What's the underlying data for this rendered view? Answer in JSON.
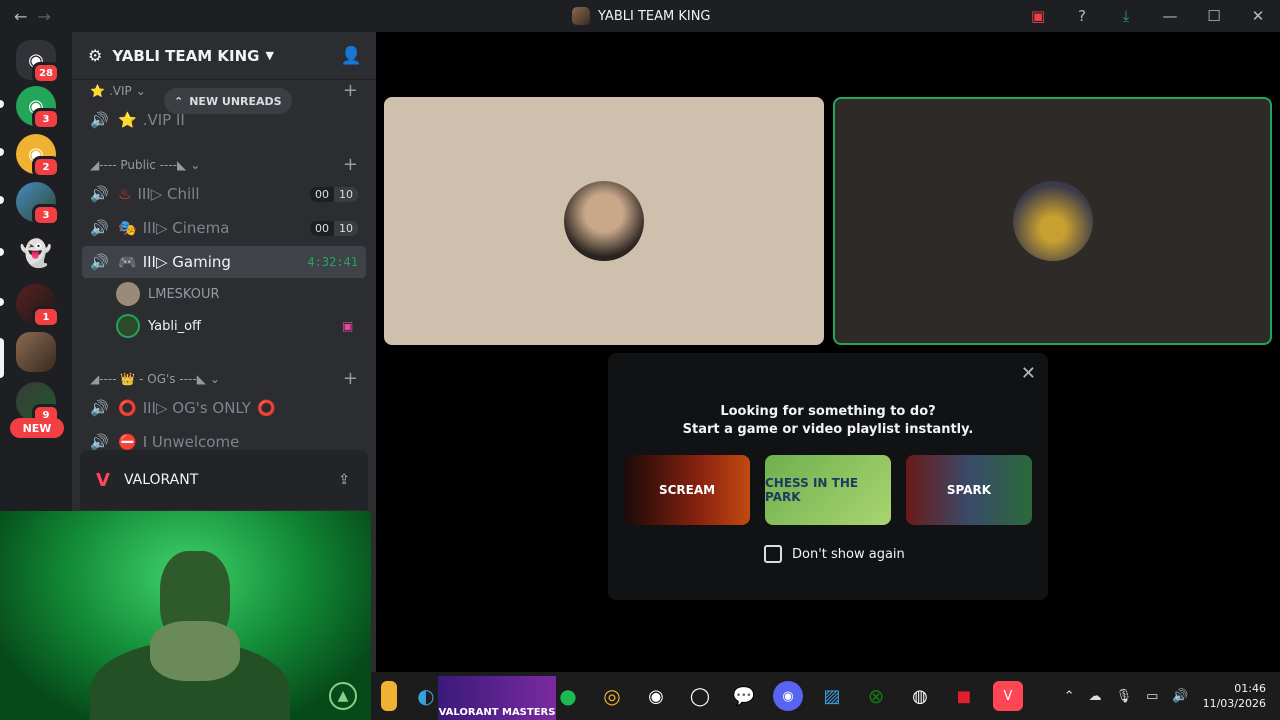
{
  "window": {
    "title": "YABLI TEAM KING",
    "back_icon": "arrow-left-icon",
    "forward_icon": "arrow-right-icon",
    "controls": {
      "minimize": "—",
      "maximize": "☐",
      "close": "✕"
    }
  },
  "rail": {
    "dm_badge": "28",
    "servers": [
      {
        "badge": "3"
      },
      {
        "badge": "2"
      },
      {
        "badge": "3"
      },
      {
        "badge": ""
      },
      {
        "badge": "1"
      },
      {
        "badge": ""
      },
      {
        "badge": "9"
      }
    ],
    "new_label": "NEW"
  },
  "server": {
    "name": "YABLI TEAM KING",
    "new_unreads": "NEW UNREADS",
    "categories": [
      {
        "name": ".VIP"
      },
      {
        "name": "◢---- Public ----◣"
      },
      {
        "name": "◢---- 👑 - OG's ----◣"
      }
    ],
    "channels": [
      {
        "name": ".VIP II",
        "emoji": "⭐"
      },
      {
        "name": "III▷ Chill",
        "emoji": "♨",
        "count_a": "00",
        "count_b": "10"
      },
      {
        "name": "III▷ Cinema",
        "emoji": "🎭",
        "count_a": "00",
        "count_b": "10"
      },
      {
        "name": "III▷ Gaming",
        "emoji": "🎮",
        "timer": "4:32:41"
      },
      {
        "name": "III▷ OG's ONLY",
        "emoji": "⭕"
      },
      {
        "name": "I Unwelcome",
        "emoji": "⛔"
      }
    ],
    "users": [
      {
        "name": "LMESKOUR"
      },
      {
        "name": "Yabli_off"
      }
    ],
    "activity": {
      "game": "VALORANT"
    }
  },
  "activities_panel": {
    "line1": "Looking for something to do?",
    "line2": "Start a game or video playlist instantly.",
    "cards": [
      "SCREAM",
      "CHESS IN THE PARK",
      "SPARK"
    ],
    "dont_show": "Don't show again"
  },
  "taskbar": {
    "valorant_banner": "VALORANT MASTERS",
    "time": "01:46",
    "date": "11/03/2026"
  }
}
